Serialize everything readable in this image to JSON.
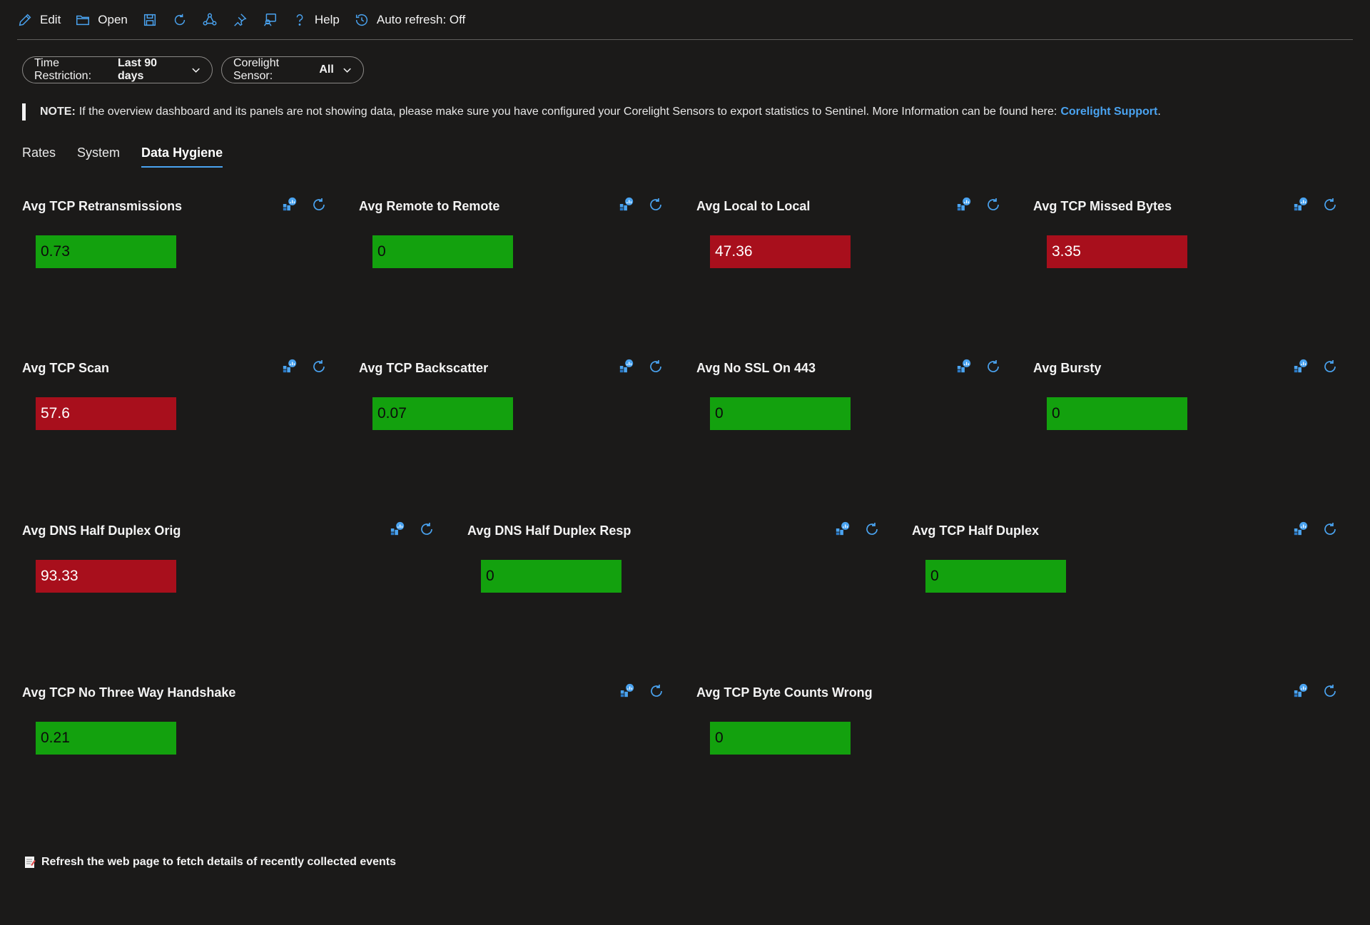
{
  "toolbar": {
    "edit": "Edit",
    "open": "Open",
    "help": "Help",
    "auto_refresh": "Auto refresh: Off"
  },
  "filters": {
    "time_label": "Time Restriction:",
    "time_value": "Last 90 days",
    "sensor_label": "Corelight Sensor:",
    "sensor_value": "All"
  },
  "note": {
    "label": "NOTE:",
    "text": "If the overview dashboard and its panels are not showing data, please make sure you have configured your Corelight Sensors to export statistics to Sentinel. More Information can be found here:",
    "link": "Corelight Support",
    "end": "."
  },
  "tabs": [
    "Rates",
    "System",
    "Data Hygiene"
  ],
  "active_tab": "Data Hygiene",
  "colors": {
    "good": "#13a10e",
    "bad": "#a80f1c",
    "accent": "#4aa3f0"
  },
  "tiles": [
    {
      "title": "Avg TCP Retransmissions",
      "value": "0.73",
      "status": "green"
    },
    {
      "title": "Avg Remote to Remote",
      "value": "0",
      "status": "green"
    },
    {
      "title": "Avg Local to Local",
      "value": "47.36",
      "status": "red"
    },
    {
      "title": "Avg TCP Missed Bytes",
      "value": "3.35",
      "status": "red"
    },
    {
      "title": "Avg TCP Scan",
      "value": "57.6",
      "status": "red"
    },
    {
      "title": "Avg TCP Backscatter",
      "value": "0.07",
      "status": "green"
    },
    {
      "title": "Avg No SSL On 443",
      "value": "0",
      "status": "green"
    },
    {
      "title": "Avg Bursty",
      "value": "0",
      "status": "green"
    },
    {
      "title": "Avg DNS Half Duplex Orig",
      "value": "93.33",
      "status": "red"
    },
    {
      "title": "Avg DNS Half Duplex Resp",
      "value": "0",
      "status": "green"
    },
    {
      "title": "Avg TCP Half Duplex",
      "value": "0",
      "status": "green"
    },
    {
      "title": "Avg TCP No Three Way Handshake",
      "value": "0.21",
      "status": "green"
    },
    {
      "title": "Avg TCP Byte Counts Wrong",
      "value": "0",
      "status": "green"
    }
  ],
  "footer": {
    "text": "Refresh the web page to fetch details of recently collected events"
  }
}
